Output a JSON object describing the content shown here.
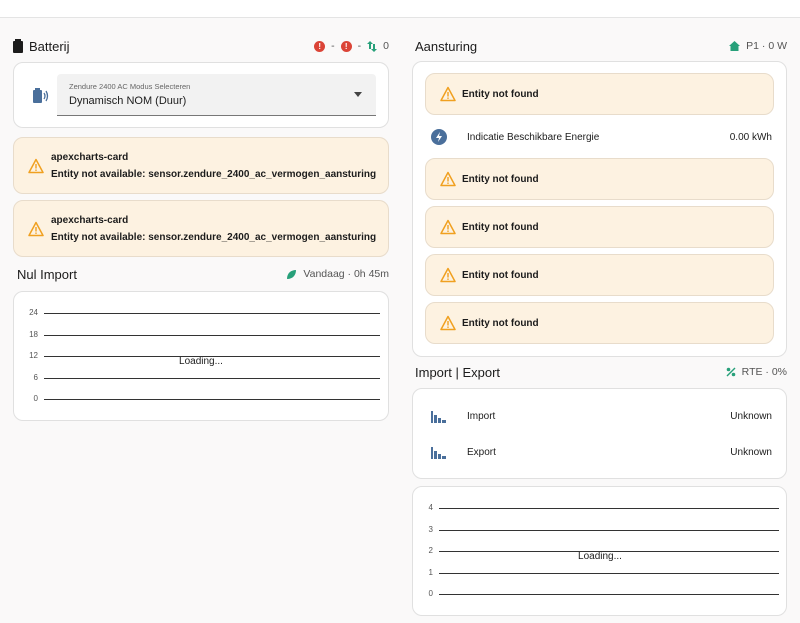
{
  "battery": {
    "title": "Batterij",
    "status": [
      {
        "icon": "alert-circle-icon",
        "text": "-"
      },
      {
        "icon": "alert-circle-icon",
        "text": "-"
      },
      {
        "icon": "transfer-icon",
        "text": "0"
      }
    ],
    "select": {
      "label": "Zendure 2400 AC Modus Selecteren",
      "value": "Dynamisch NOM (Duur)"
    },
    "errors": [
      {
        "title": "apexcharts-card",
        "message": "Entity not available: sensor.zendure_2400_ac_vermogen_aansturing"
      },
      {
        "title": "apexcharts-card",
        "message": "Entity not available: sensor.zendure_2400_ac_vermogen_aansturing"
      }
    ]
  },
  "nul_import": {
    "title": "Nul Import",
    "badge": "Vandaag · 0h 45m",
    "loading": "Loading...",
    "ticks": [
      "24",
      "18",
      "12",
      "6",
      "0"
    ]
  },
  "aansturing": {
    "title": "Aansturing",
    "badge": "P1 · 0 W",
    "not_found": "Entity not found",
    "energy_label": "Indicatie Beschikbare Energie",
    "energy_value": "0.00 kWh"
  },
  "import_export": {
    "title": "Import | Export",
    "badge": "RTE · 0%",
    "rows": [
      {
        "label": "Import",
        "value": "Unknown"
      },
      {
        "label": "Export",
        "value": "Unknown"
      }
    ],
    "loading": "Loading...",
    "ticks": [
      "4",
      "3",
      "2",
      "1",
      "0"
    ]
  },
  "colors": {
    "accent_blue": "#4a6f9b",
    "warning": "#f0a020",
    "warning_bg": "#fdf2e1",
    "error_red": "#db4437",
    "success_green": "#27a07a"
  }
}
